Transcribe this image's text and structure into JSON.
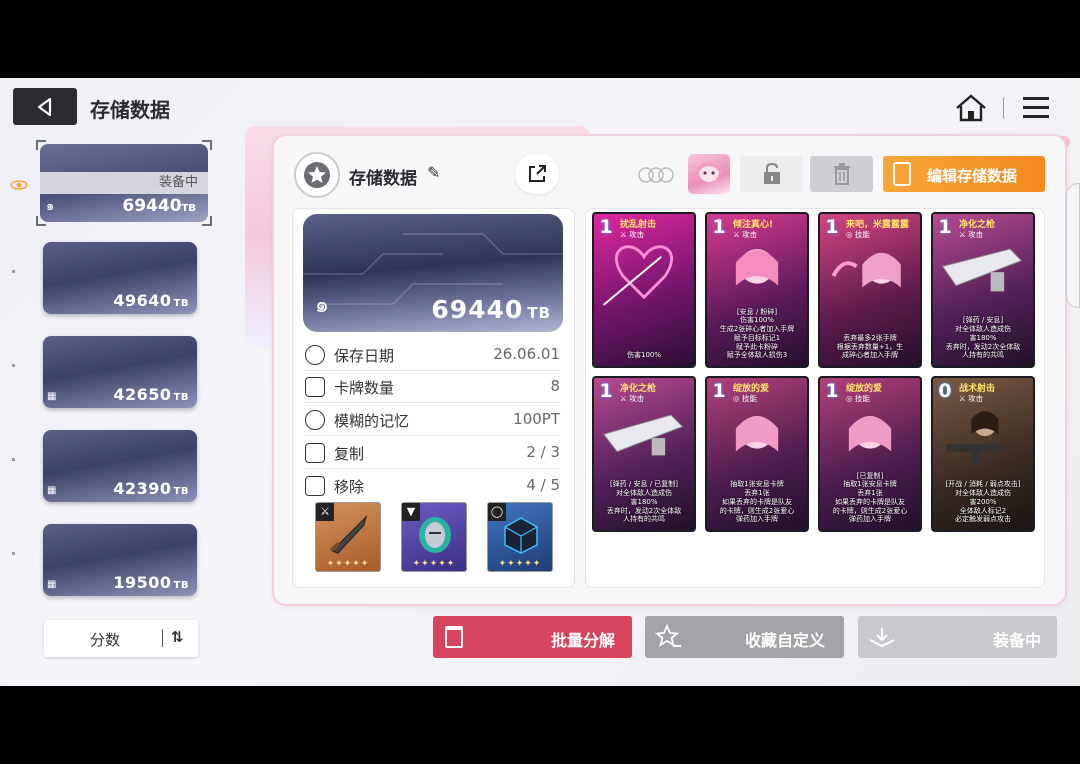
{
  "header": {
    "title": "存储数据",
    "back_icon": "back-arrow-icon",
    "home_icon": "home-icon",
    "menu_icon": "hamburger-menu-icon"
  },
  "sidebar": {
    "selected": {
      "badge": "装备中",
      "value": "69440",
      "unit": "TB"
    },
    "slots": [
      {
        "value": "49640",
        "unit": "TB"
      },
      {
        "value": "42650",
        "unit": "TB"
      },
      {
        "value": "42390",
        "unit": "TB"
      },
      {
        "value": "19500",
        "unit": "TB"
      }
    ],
    "sort": {
      "label": "分数",
      "icon": "sort-order-icon"
    }
  },
  "panel": {
    "title": "存储数据",
    "edit_icon": "pencil-icon",
    "share_icon": "share-icon",
    "edit_data_label": "编辑存储数据",
    "lock_icon": "unlock-icon",
    "delete_icon": "trash-icon"
  },
  "info": {
    "cover_value": "69440",
    "cover_unit": "TB",
    "rows": [
      {
        "label": "保存日期",
        "value": "26.06.01",
        "icon": "clock-icon"
      },
      {
        "label": "卡牌数量",
        "value": "8",
        "icon": "card-icon"
      },
      {
        "label": "模糊的记忆",
        "value": "100PT",
        "icon": "brain-icon"
      },
      {
        "label": "复制",
        "value": "2 / 3",
        "icon": "copy-icon"
      },
      {
        "label": "移除",
        "value": "4 / 5",
        "icon": "remove-icon"
      }
    ],
    "equipment": [
      {
        "name": "weapon",
        "icon": "sword-icon",
        "stars": "✦✦✦✦✦",
        "color": "#c0703a"
      },
      {
        "name": "armor",
        "icon": "armor-icon",
        "stars": "✦✦✦✦✦",
        "color": "#5a4aa8"
      },
      {
        "name": "accessory",
        "icon": "ring-icon",
        "stars": "✦✦✦✦✦",
        "color": "#2f5a9a"
      }
    ]
  },
  "cards": [
    {
      "cost": "1",
      "name": "扰乱射击",
      "type": "⚔ 攻击",
      "desc": "伤害100%",
      "color": "#b0178a"
    },
    {
      "cost": "1",
      "name": "倾注真心!",
      "type": "⚔ 攻击",
      "desc": "[安息 / 粉碎]\n伤害100%\n生成2张碎心者加入手牌\n赋予目标标记1\n赋予此卡粉碎\n赋予全体敌人损伤3",
      "color": "#c41f78"
    },
    {
      "cost": "1",
      "name": "来吧，米露露露",
      "type": "◎ 技能",
      "desc": "丢弃最多2张手牌\n根据丢弃数量+1，生\n成碎心者加入手牌",
      "color": "#c02d6c"
    },
    {
      "cost": "1",
      "name": "净化之枪",
      "type": "⚔ 攻击",
      "desc": "[弹药 / 安息]\n对全体敌人造成伤\n害180%\n丢弃时，发动2次全体敌\n人持有的共鸣",
      "color": "#9b2a78"
    },
    {
      "cost": "1",
      "name": "净化之枪",
      "type": "⚔ 攻击",
      "desc": "[弹药 / 安息 / 已复制]\n对全体敌人造成伤\n害180%\n丢弃时，发动2次全体敌\n人持有的共鸣",
      "color": "#9b2a78"
    },
    {
      "cost": "1",
      "name": "绽放的爱",
      "type": "◎ 技能",
      "desc": "抽取1张安息卡牌\n丢弃1张\n如果丢弃的卡牌是队友\n的卡牌，则生成2张爱心\n弹药加入手牌",
      "color": "#b8256e"
    },
    {
      "cost": "1",
      "name": "绽放的爱",
      "type": "◎ 技能",
      "desc": "[已复制]\n抽取1张安息卡牌\n丢弃1张\n如果丢弃的卡牌是队友\n的卡牌，则生成2张爱心\n弹药加入手牌",
      "color": "#b8256e"
    },
    {
      "cost": "0",
      "name": "战术射击",
      "type": "⚔ 攻击",
      "desc": "[开战 / 消耗 / 弱点攻击]\n对全体敌人造成伤\n害200%\n全体敌人标记2\n必定触发弱点攻击",
      "color": "#5a3b2a"
    }
  ],
  "bottom": {
    "batch_label": "批量分解",
    "favorite_label": "收藏自定义",
    "equipped_label": "装备中"
  },
  "colors": {
    "accent": "#f3891d",
    "danger": "#d8435e",
    "dark": "#2b2c31"
  }
}
